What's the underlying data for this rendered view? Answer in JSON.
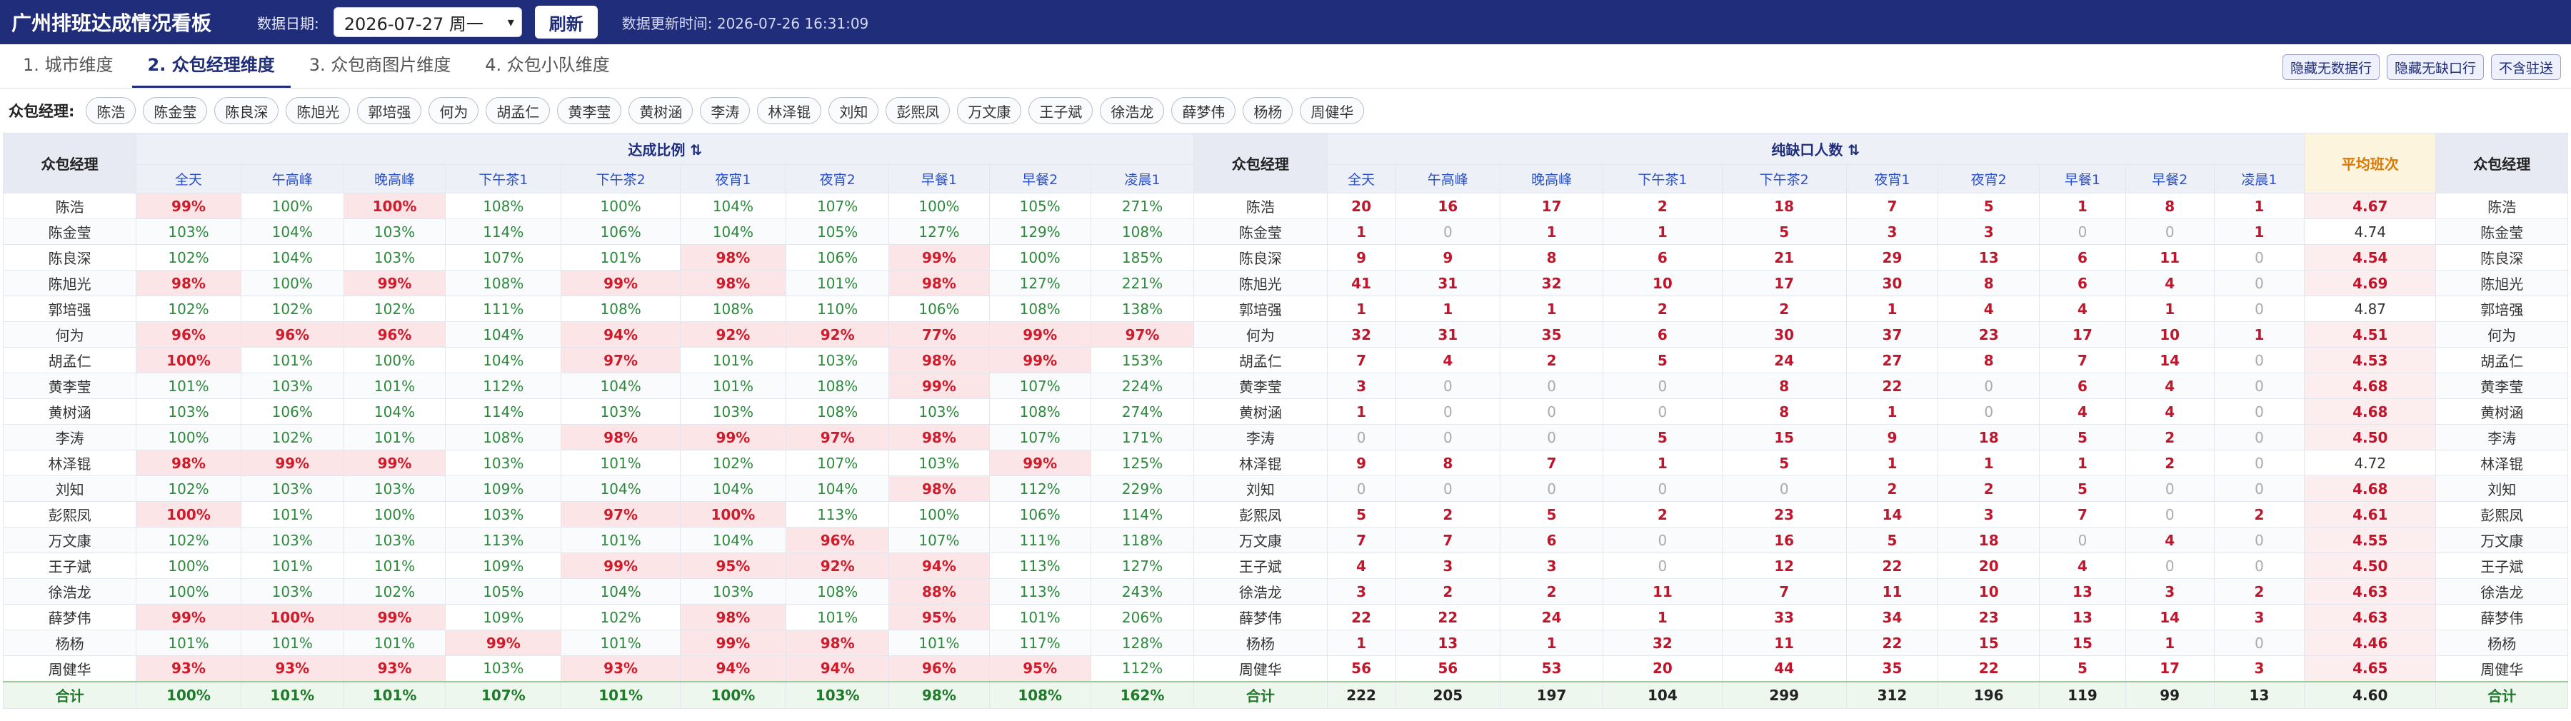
{
  "app": {
    "title": "广州排班达成情况看板",
    "date_label": "数据日期:",
    "date_value": "2026-07-27 周一",
    "refresh_label": "刷新",
    "update_info": "数据更新时间: 2026-07-26 16:31:09"
  },
  "tabs": [
    {
      "label": "1. 城市维度",
      "active": false
    },
    {
      "label": "2. 众包经理维度",
      "active": true
    },
    {
      "label": "3. 众包商图片维度",
      "active": false
    },
    {
      "label": "4. 众包小队维度",
      "active": false
    }
  ],
  "toggles": [
    "隐藏无数据行",
    "隐藏无缺口行",
    "不含驻送"
  ],
  "filter": {
    "label": "众包经理:",
    "chips": [
      "陈浩",
      "陈金莹",
      "陈良深",
      "陈旭光",
      "郭培强",
      "何为",
      "胡孟仁",
      "黄李莹",
      "黄树涵",
      "李涛",
      "林泽锟",
      "刘知",
      "彭熙凤",
      "万文康",
      "王子斌",
      "徐浩龙",
      "薛梦伟",
      "杨杨",
      "周健华"
    ]
  },
  "table": {
    "name_header": "众包经理",
    "rate_group": "达成比例 ⇅",
    "gap_group": "纯缺口人数 ⇅",
    "avg_header": "平均班次",
    "rate_cols": [
      "全天",
      "午高峰",
      "晚高峰",
      "下午茶1",
      "下午茶2",
      "夜宵1",
      "夜宵2",
      "早餐1",
      "早餐2",
      "凌晨1"
    ],
    "gap_cols": [
      "全天",
      "午高峰",
      "晚高峰",
      "下午茶1",
      "下午茶2",
      "夜宵1",
      "夜宵2",
      "早餐1",
      "早餐2",
      "凌晨1"
    ],
    "rows": [
      {
        "name": "陈浩",
        "rates": [
          "99%",
          "100%",
          "100%",
          "108%",
          "100%",
          "104%",
          "107%",
          "100%",
          "105%",
          "271%"
        ],
        "low": [
          1,
          0,
          1,
          0,
          0,
          0,
          0,
          0,
          0,
          0
        ],
        "gaps": [
          20,
          16,
          17,
          2,
          18,
          7,
          5,
          1,
          8,
          1
        ],
        "avg": "4.67",
        "avg_flag": true
      },
      {
        "name": "陈金莹",
        "rates": [
          "103%",
          "104%",
          "103%",
          "114%",
          "106%",
          "104%",
          "105%",
          "127%",
          "129%",
          "108%"
        ],
        "low": [
          0,
          0,
          0,
          0,
          0,
          0,
          0,
          0,
          0,
          0
        ],
        "gaps": [
          1,
          0,
          1,
          1,
          5,
          3,
          3,
          0,
          0,
          1
        ],
        "avg": "4.74",
        "avg_flag": false
      },
      {
        "name": "陈良深",
        "rates": [
          "102%",
          "104%",
          "103%",
          "107%",
          "101%",
          "98%",
          "106%",
          "99%",
          "100%",
          "185%"
        ],
        "low": [
          0,
          0,
          0,
          0,
          0,
          1,
          0,
          1,
          0,
          0
        ],
        "gaps": [
          9,
          9,
          8,
          6,
          21,
          29,
          13,
          6,
          11,
          0
        ],
        "avg": "4.54",
        "avg_flag": true
      },
      {
        "name": "陈旭光",
        "rates": [
          "98%",
          "100%",
          "99%",
          "108%",
          "99%",
          "98%",
          "101%",
          "98%",
          "127%",
          "221%"
        ],
        "low": [
          1,
          0,
          1,
          0,
          1,
          1,
          0,
          1,
          0,
          0
        ],
        "gaps": [
          41,
          31,
          32,
          10,
          17,
          30,
          8,
          6,
          4,
          0
        ],
        "avg": "4.69",
        "avg_flag": true
      },
      {
        "name": "郭培强",
        "rates": [
          "102%",
          "102%",
          "102%",
          "111%",
          "108%",
          "108%",
          "110%",
          "106%",
          "108%",
          "138%"
        ],
        "low": [
          0,
          0,
          0,
          0,
          0,
          0,
          0,
          0,
          0,
          0
        ],
        "gaps": [
          1,
          1,
          1,
          2,
          2,
          1,
          4,
          4,
          1,
          0
        ],
        "avg": "4.87",
        "avg_flag": false
      },
      {
        "name": "何为",
        "rates": [
          "96%",
          "96%",
          "96%",
          "104%",
          "94%",
          "92%",
          "92%",
          "77%",
          "99%",
          "97%"
        ],
        "low": [
          1,
          1,
          1,
          0,
          1,
          1,
          1,
          1,
          1,
          1
        ],
        "gaps": [
          32,
          31,
          35,
          6,
          30,
          37,
          23,
          17,
          10,
          1
        ],
        "avg": "4.51",
        "avg_flag": true
      },
      {
        "name": "胡孟仁",
        "rates": [
          "100%",
          "101%",
          "100%",
          "104%",
          "97%",
          "101%",
          "103%",
          "98%",
          "99%",
          "153%"
        ],
        "low": [
          1,
          0,
          0,
          0,
          1,
          0,
          0,
          1,
          1,
          0
        ],
        "gaps": [
          7,
          4,
          2,
          5,
          24,
          27,
          8,
          7,
          14,
          0
        ],
        "avg": "4.53",
        "avg_flag": true
      },
      {
        "name": "黄李莹",
        "rates": [
          "101%",
          "103%",
          "101%",
          "112%",
          "104%",
          "101%",
          "108%",
          "99%",
          "107%",
          "224%"
        ],
        "low": [
          0,
          0,
          0,
          0,
          0,
          0,
          0,
          1,
          0,
          0
        ],
        "gaps": [
          3,
          0,
          0,
          0,
          8,
          22,
          0,
          6,
          4,
          0
        ],
        "avg": "4.68",
        "avg_flag": true
      },
      {
        "name": "黄树涵",
        "rates": [
          "103%",
          "106%",
          "104%",
          "114%",
          "103%",
          "103%",
          "108%",
          "103%",
          "108%",
          "274%"
        ],
        "low": [
          0,
          0,
          0,
          0,
          0,
          0,
          0,
          0,
          0,
          0
        ],
        "gaps": [
          1,
          0,
          0,
          0,
          8,
          1,
          0,
          4,
          4,
          0
        ],
        "avg": "4.68",
        "avg_flag": true
      },
      {
        "name": "李涛",
        "rates": [
          "100%",
          "102%",
          "101%",
          "108%",
          "98%",
          "99%",
          "97%",
          "98%",
          "107%",
          "171%"
        ],
        "low": [
          0,
          0,
          0,
          0,
          1,
          1,
          1,
          1,
          0,
          0
        ],
        "gaps": [
          0,
          0,
          0,
          5,
          15,
          9,
          18,
          5,
          2,
          0
        ],
        "avg": "4.50",
        "avg_flag": true
      },
      {
        "name": "林泽锟",
        "rates": [
          "98%",
          "99%",
          "99%",
          "103%",
          "101%",
          "102%",
          "107%",
          "103%",
          "99%",
          "125%"
        ],
        "low": [
          1,
          1,
          1,
          0,
          0,
          0,
          0,
          0,
          1,
          0
        ],
        "gaps": [
          9,
          8,
          7,
          1,
          5,
          1,
          1,
          1,
          2,
          0
        ],
        "avg": "4.72",
        "avg_flag": false
      },
      {
        "name": "刘知",
        "rates": [
          "102%",
          "103%",
          "103%",
          "109%",
          "104%",
          "104%",
          "104%",
          "98%",
          "112%",
          "229%"
        ],
        "low": [
          0,
          0,
          0,
          0,
          0,
          0,
          0,
          1,
          0,
          0
        ],
        "gaps": [
          0,
          0,
          0,
          0,
          0,
          2,
          2,
          5,
          0,
          0
        ],
        "avg": "4.68",
        "avg_flag": true
      },
      {
        "name": "彭熙凤",
        "rates": [
          "100%",
          "101%",
          "100%",
          "103%",
          "97%",
          "100%",
          "113%",
          "100%",
          "106%",
          "114%"
        ],
        "low": [
          1,
          0,
          0,
          0,
          1,
          1,
          0,
          0,
          0,
          0
        ],
        "gaps": [
          5,
          2,
          5,
          2,
          23,
          14,
          3,
          7,
          0,
          2
        ],
        "avg": "4.61",
        "avg_flag": true
      },
      {
        "name": "万文康",
        "rates": [
          "102%",
          "103%",
          "103%",
          "113%",
          "101%",
          "104%",
          "96%",
          "107%",
          "111%",
          "118%"
        ],
        "low": [
          0,
          0,
          0,
          0,
          0,
          0,
          1,
          0,
          0,
          0
        ],
        "gaps": [
          7,
          7,
          6,
          0,
          16,
          5,
          18,
          0,
          4,
          0
        ],
        "avg": "4.55",
        "avg_flag": true
      },
      {
        "name": "王子斌",
        "rates": [
          "100%",
          "101%",
          "101%",
          "109%",
          "99%",
          "95%",
          "92%",
          "94%",
          "113%",
          "127%"
        ],
        "low": [
          0,
          0,
          0,
          0,
          1,
          1,
          1,
          1,
          0,
          0
        ],
        "gaps": [
          4,
          3,
          3,
          0,
          12,
          22,
          20,
          4,
          0,
          0
        ],
        "avg": "4.50",
        "avg_flag": true
      },
      {
        "name": "徐浩龙",
        "rates": [
          "100%",
          "103%",
          "102%",
          "105%",
          "104%",
          "103%",
          "108%",
          "88%",
          "113%",
          "243%"
        ],
        "low": [
          0,
          0,
          0,
          0,
          0,
          0,
          0,
          1,
          0,
          0
        ],
        "gaps": [
          3,
          2,
          2,
          11,
          7,
          11,
          10,
          13,
          3,
          2
        ],
        "avg": "4.63",
        "avg_flag": true
      },
      {
        "name": "薛梦伟",
        "rates": [
          "99%",
          "100%",
          "99%",
          "109%",
          "102%",
          "98%",
          "101%",
          "95%",
          "101%",
          "206%"
        ],
        "low": [
          1,
          1,
          1,
          0,
          0,
          1,
          0,
          1,
          0,
          0
        ],
        "gaps": [
          22,
          22,
          24,
          1,
          33,
          34,
          23,
          13,
          14,
          3
        ],
        "avg": "4.63",
        "avg_flag": true
      },
      {
        "name": "杨杨",
        "rates": [
          "101%",
          "101%",
          "101%",
          "99%",
          "101%",
          "99%",
          "98%",
          "101%",
          "117%",
          "128%"
        ],
        "low": [
          0,
          0,
          0,
          1,
          0,
          1,
          1,
          0,
          0,
          0
        ],
        "gaps": [
          1,
          13,
          1,
          32,
          11,
          22,
          15,
          15,
          1,
          0
        ],
        "avg": "4.46",
        "avg_flag": true
      },
      {
        "name": "周健华",
        "rates": [
          "93%",
          "93%",
          "93%",
          "103%",
          "93%",
          "94%",
          "94%",
          "96%",
          "95%",
          "112%"
        ],
        "low": [
          1,
          1,
          1,
          0,
          1,
          1,
          1,
          1,
          1,
          0
        ],
        "gaps": [
          56,
          56,
          53,
          20,
          44,
          35,
          22,
          5,
          17,
          3
        ],
        "avg": "4.65",
        "avg_flag": true
      }
    ],
    "total": {
      "name": "合计",
      "rates": [
        "100%",
        "101%",
        "101%",
        "107%",
        "101%",
        "100%",
        "103%",
        "98%",
        "108%",
        "162%"
      ],
      "gaps": [
        222,
        205,
        197,
        104,
        299,
        312,
        196,
        119,
        99,
        13
      ],
      "avg": "4.60"
    }
  }
}
